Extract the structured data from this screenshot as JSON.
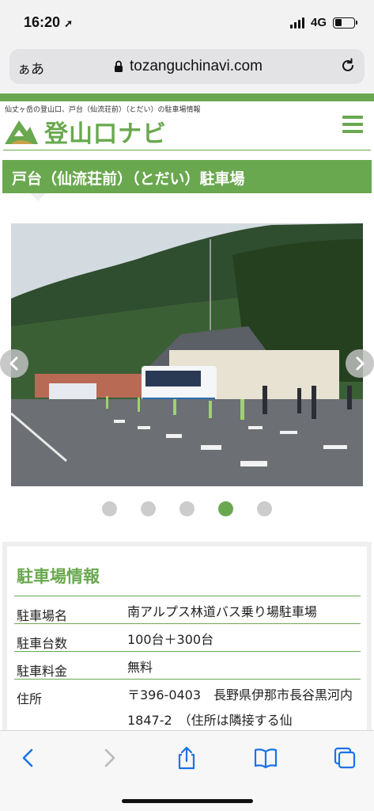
{
  "status_bar": {
    "time": "16:20",
    "network": "4G"
  },
  "url_bar": {
    "text_size_label": "ぁあ",
    "url": "tozanguchinavi.com"
  },
  "site": {
    "tagline": "仙丈ヶ岳の登山口、戸台（仙流荘前）（とだい）の駐車場情報",
    "logo_text": "登山口ナビ"
  },
  "page_title": "戸台（仙流荘前）（とだい）駐車場",
  "carousel": {
    "slide_count": 5,
    "active_slide": 4
  },
  "info": {
    "heading": "駐車場情報",
    "rows": [
      {
        "label": "駐車場名",
        "value": "南アルプス林道バス乗り場駐車場"
      },
      {
        "label": "駐車台数",
        "value": "100台＋300台"
      },
      {
        "label": "駐車料金",
        "value": "無料"
      },
      {
        "label": "住所",
        "value": "〒396-0403　長野県伊那市長谷黒河内1847-2　（住所は隣接する仙"
      }
    ]
  },
  "colors": {
    "accent": "#6aa84f",
    "ios_blue": "#1a73e8"
  }
}
